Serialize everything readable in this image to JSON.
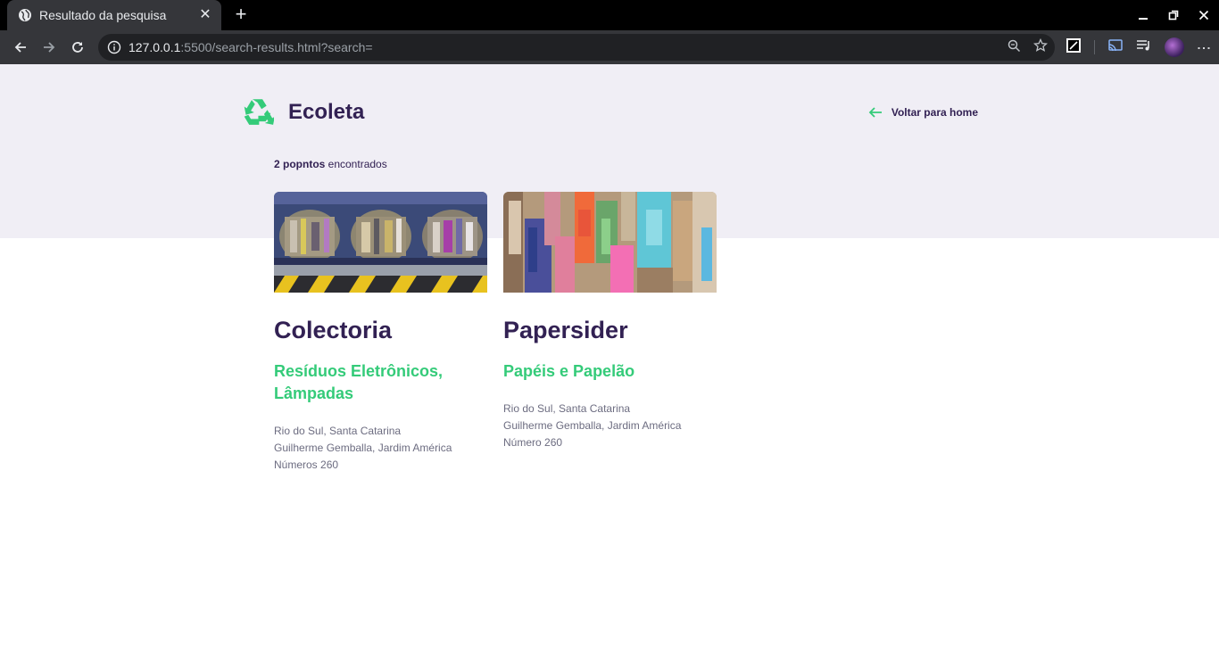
{
  "browser": {
    "tab_title": "Resultado da pesquisa",
    "url_host": "127.0.0.1",
    "url_rest": ":5500/search-results.html?search="
  },
  "header": {
    "logo_text": "Ecoleta",
    "back_label": "Voltar para home"
  },
  "results": {
    "count_bold": "2 popntos",
    "count_rest": " encontrados"
  },
  "cards": [
    {
      "name": "Colectoria",
      "items": "Resíduos Eletrônicos, Lâmpadas",
      "address": [
        "Rio do Sul, Santa Catarina",
        "Guilherme Gemballa, Jardim América",
        "Números 260"
      ]
    },
    {
      "name": "Papersider",
      "items": "Papéis e Papelão",
      "address": [
        "Rio do Sul, Santa Catarina",
        "Guilherme Gemballa, Jardim América",
        "Número 260"
      ]
    }
  ],
  "colors": {
    "brand_purple": "#322153",
    "brand_green": "#34cb79",
    "hero_bg": "#f0eef5",
    "text_muted": "#6c6c80"
  },
  "icons": [
    "globe-icon",
    "close-icon",
    "plus-icon",
    "minimize-icon",
    "restore-icon",
    "window-close-icon",
    "back-arrow-icon",
    "forward-arrow-icon",
    "reload-icon",
    "info-icon",
    "zoom-icon",
    "star-icon",
    "extension-icon",
    "cast-icon",
    "media-queue-icon",
    "profile-avatar",
    "menu-icon",
    "recycle-icon",
    "arrow-left-icon"
  ]
}
